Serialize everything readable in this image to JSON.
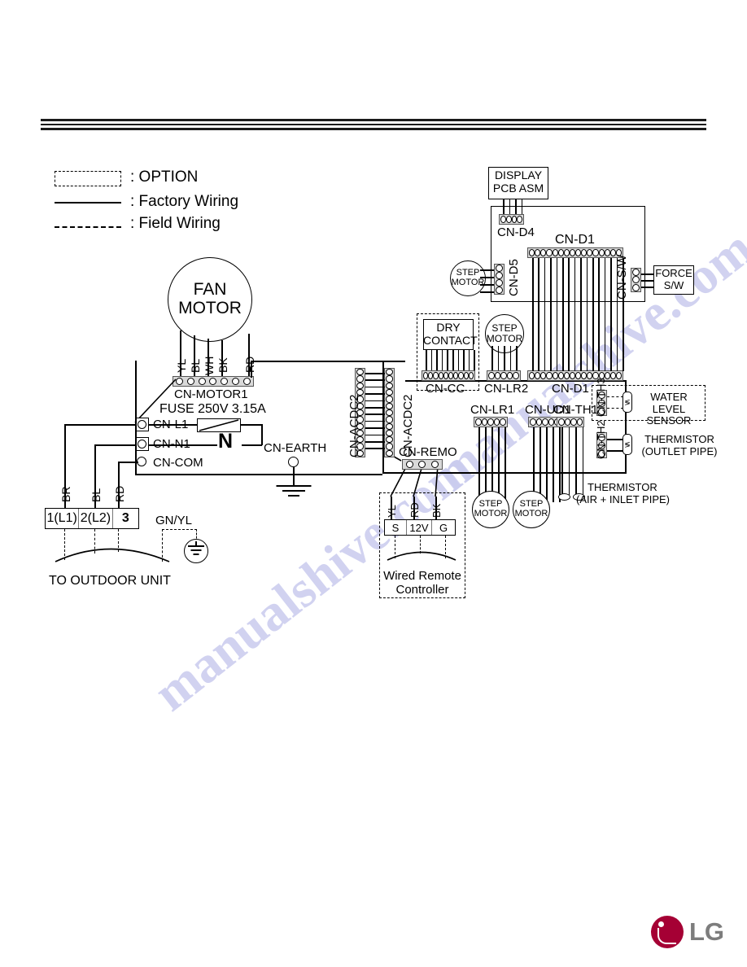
{
  "document": {
    "type": "wiring-diagram",
    "brand": "LG"
  },
  "legend": {
    "option": ": OPTION",
    "factory_wiring": ": Factory Wiring",
    "field_wiring": ": Field Wiring"
  },
  "fan_motor": {
    "label_line1": "FAN",
    "label_line2": "MOTOR",
    "connector": "CN-MOTOR1",
    "wire_colors": [
      "YL",
      "BL",
      "WH",
      "BK",
      "RD"
    ],
    "pin_count": 7
  },
  "power": {
    "fuse": "FUSE 250V 3.15A",
    "neutral": "N",
    "terminals": [
      {
        "name": "CN-L1"
      },
      {
        "name": "CN-N1"
      },
      {
        "name": "CN-COM"
      }
    ],
    "earth_terminal": "CN-EARTH",
    "ground_label": "GN/YL"
  },
  "terminal_block": {
    "cells": [
      "1(L1)",
      "2(L2)",
      "3"
    ],
    "wire_colors": [
      "BR",
      "BL",
      "RD"
    ],
    "destination": "TO OUTDOOR UNIT"
  },
  "main_pcb": {
    "acdc_left": "CN-ACDC2",
    "acdc_right": "CN-ACDC2",
    "acdc_pin_count": 13,
    "remote_connector": "CN-REMO",
    "remote_pin_count": 3
  },
  "dry_contact": {
    "title_line1": "DRY",
    "title_line2": "CONTACT",
    "connector": "CN-CC",
    "pin_count": 10
  },
  "display_pcb": {
    "title_line1": "DISPLAY",
    "title_line2": "PCB ASM",
    "connector": "CN-D4",
    "d4_pin_count": 4,
    "main_connector_top": "CN-D1",
    "main_connector_bottom": "CN-D1",
    "d1_pin_count": 16,
    "step_motor_connector": "CN-D5",
    "d5_pin_count": 4,
    "switch_connector": "CN-S/W",
    "sw_pin_count": 3,
    "force_switch_line1": "FORCE",
    "force_switch_line2": "S/W"
  },
  "step_motors": [
    {
      "connector": "CN-D5",
      "line1": "STEP",
      "line2": "MOTOR"
    },
    {
      "connector": "CN-LR2",
      "line1": "STEP",
      "line2": "MOTOR"
    },
    {
      "connector": "CN-LR1",
      "line1": "STEP",
      "line2": "MOTOR"
    },
    {
      "connector": "CN-UD1",
      "line1": "STEP",
      "line2": "MOTOR"
    }
  ],
  "connectors": {
    "lr2": "CN-LR2",
    "lr2_pins": 5,
    "lr1": "CN-LR1",
    "lr1_pins": 5,
    "ud1": "CN-UD1",
    "ud1_pins": 5,
    "th1": "CN-TH1",
    "th1_pins": 4,
    "th2": "CN-TH2",
    "th2_pins": 3,
    "th3": "CN-TH3",
    "th3_pins": 3
  },
  "sensors": {
    "water_level_line1": "WATER LEVEL",
    "water_level_line2": "SENSOR",
    "thermistor_outlet_line1": "THERMISTOR",
    "thermistor_outlet_line2": "(OUTLET PIPE)",
    "thermistor_air_line1": "THERMISTOR",
    "thermistor_air_line2": "(AIR + INLET PIPE)"
  },
  "wired_remote": {
    "title_line1": "Wired Remote",
    "title_line2": "Controller",
    "wire_colors": [
      "YL",
      "RD",
      "BK"
    ],
    "terminals": [
      "S",
      "12V",
      "G"
    ]
  },
  "watermark": {
    "text": "manualshive.com"
  },
  "colors": {
    "ink": "#000000",
    "brand": "#a50034",
    "logo_text": "#7d7d7d",
    "watermark": "#c9cbee",
    "connector_body": "#d9d9d9"
  }
}
